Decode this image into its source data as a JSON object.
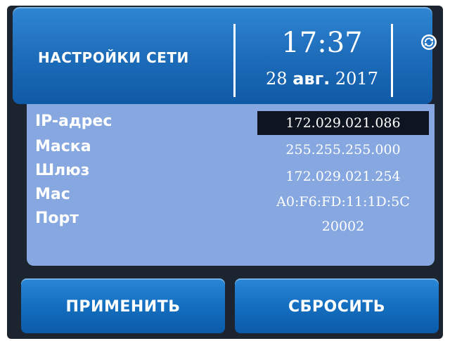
{
  "header": {
    "title": "НАСТРОЙКИ СЕТИ",
    "time": "17:37",
    "date_day": "28",
    "date_month": "авг.",
    "date_year": "2017",
    "sync_icon": "sync-icon"
  },
  "network": {
    "ip_label": "IP-адрес",
    "ip_value": "172.029.021.086",
    "mask_label": "Маска",
    "mask_value": "255.255.255.000",
    "gateway_label": "Шлюз",
    "gateway_value": "172.029.021.254",
    "mac_label": "Mac",
    "mac_value": "A0:F6:FD:11:1D:5C",
    "port_label": "Порт",
    "port_value": "20002"
  },
  "buttons": {
    "apply": "ПРИМЕНИТЬ",
    "reset": "СБРОСИТЬ"
  },
  "colors": {
    "header_blue": "#1f6fbd",
    "panel_blue": "#86a7df",
    "selected_bg": "#0f1520",
    "frame": "#1c2430"
  }
}
